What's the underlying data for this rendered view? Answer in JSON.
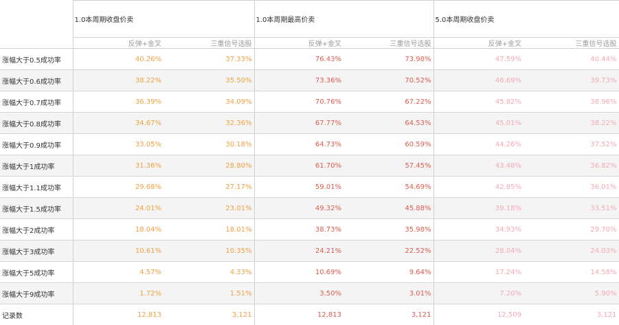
{
  "groups": [
    {
      "title": "1.0本周期收盘价卖"
    },
    {
      "title": "1.0本周期最高价卖"
    },
    {
      "title": "5.0本周期收盘价卖"
    }
  ],
  "subheaders": [
    "反弹+金叉",
    "三重信号选股",
    "反弹+金叉",
    "三重信号选股",
    "反弹+金叉",
    "三重信号选股"
  ],
  "rows": [
    {
      "label": "涨幅大于0.5成功率",
      "values": [
        "40.26%",
        "37.33%",
        "76.43%",
        "73.98%",
        "47.59%",
        "40.44%"
      ]
    },
    {
      "label": "涨幅大于0.6成功率",
      "values": [
        "38.22%",
        "35.50%",
        "73.36%",
        "70.52%",
        "46.69%",
        "39.73%"
      ]
    },
    {
      "label": "涨幅大于0.7成功率",
      "values": [
        "36.39%",
        "34.09%",
        "70.76%",
        "67.22%",
        "45.82%",
        "38.96%"
      ]
    },
    {
      "label": "涨幅大于0.8成功率",
      "values": [
        "34.67%",
        "32.36%",
        "67.77%",
        "64.53%",
        "45.01%",
        "38.22%"
      ]
    },
    {
      "label": "涨幅大于0.9成功率",
      "values": [
        "33.05%",
        "30.18%",
        "64.73%",
        "60.59%",
        "44.26%",
        "37.52%"
      ]
    },
    {
      "label": "涨幅大于1成功率",
      "values": [
        "31.36%",
        "28.80%",
        "61.70%",
        "57.45%",
        "43.48%",
        "36.82%"
      ]
    },
    {
      "label": "涨幅大于1.1成功率",
      "values": [
        "29.68%",
        "27.17%",
        "59.01%",
        "54.69%",
        "42.85%",
        "36.01%"
      ]
    },
    {
      "label": "涨幅大于1.5成功率",
      "values": [
        "24.01%",
        "23.01%",
        "49.32%",
        "45.88%",
        "39.18%",
        "33.51%"
      ]
    },
    {
      "label": "涨幅大于2成功率",
      "values": [
        "18.04%",
        "18.01%",
        "38.73%",
        "35.98%",
        "34.93%",
        "29.70%"
      ]
    },
    {
      "label": "涨幅大于3成功率",
      "values": [
        "10.61%",
        "10.35%",
        "24.21%",
        "22.52%",
        "28.04%",
        "24.03%"
      ]
    },
    {
      "label": "涨幅大于5成功率",
      "values": [
        "4.57%",
        "4.33%",
        "10.69%",
        "9.64%",
        "17.24%",
        "14.58%"
      ]
    },
    {
      "label": "涨幅大于9成功率",
      "values": [
        "1.72%",
        "1.51%",
        "3.50%",
        "3.01%",
        "7.20%",
        "5.90%"
      ]
    }
  ],
  "total": {
    "label": "记录数",
    "values": [
      "12,813",
      "3,121",
      "12,813",
      "3,121",
      "12,509",
      "3,121"
    ]
  },
  "colors": {
    "group1": "#f0a040",
    "group2": "#e05a4e",
    "group3": "#f5a8b4"
  }
}
